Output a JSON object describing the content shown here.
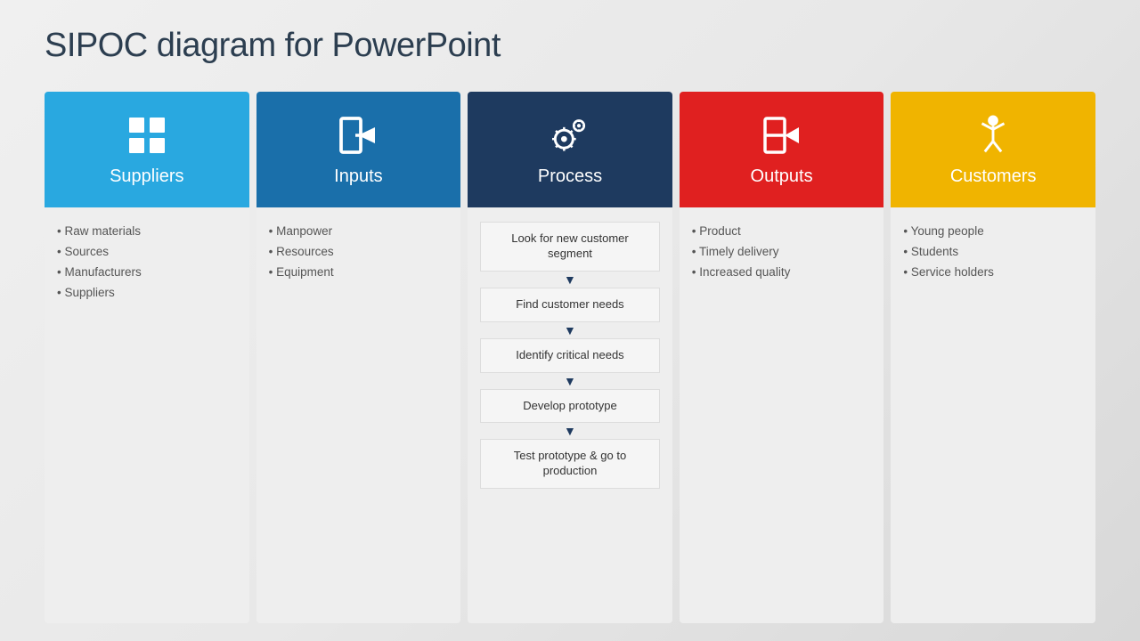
{
  "page": {
    "title": "SIPOC diagram for PowerPoint"
  },
  "columns": [
    {
      "id": "suppliers",
      "label": "Suppliers",
      "color_class": "suppliers",
      "icon": "grid",
      "content_type": "bullets",
      "bullets": [
        "Raw materials",
        "Sources",
        "Manufacturers",
        "Suppliers"
      ]
    },
    {
      "id": "inputs",
      "label": "Inputs",
      "color_class": "inputs",
      "icon": "signin",
      "content_type": "bullets",
      "bullets": [
        "Manpower",
        "Resources",
        "Equipment"
      ]
    },
    {
      "id": "process",
      "label": "Process",
      "color_class": "process",
      "icon": "gears",
      "content_type": "steps",
      "steps": [
        "Look for new customer segment",
        "Find customer needs",
        "Identify critical needs",
        "Develop prototype",
        "Test prototype & go to production"
      ]
    },
    {
      "id": "outputs",
      "label": "Outputs",
      "color_class": "outputs",
      "icon": "signout",
      "content_type": "bullets",
      "bullets": [
        "Product",
        "Timely delivery",
        "Increased quality"
      ]
    },
    {
      "id": "customers",
      "label": "Customers",
      "color_class": "customers",
      "icon": "person",
      "content_type": "bullets",
      "bullets": [
        "Young people",
        "Students",
        "Service holders"
      ]
    }
  ],
  "arrow_symbol": "▼"
}
